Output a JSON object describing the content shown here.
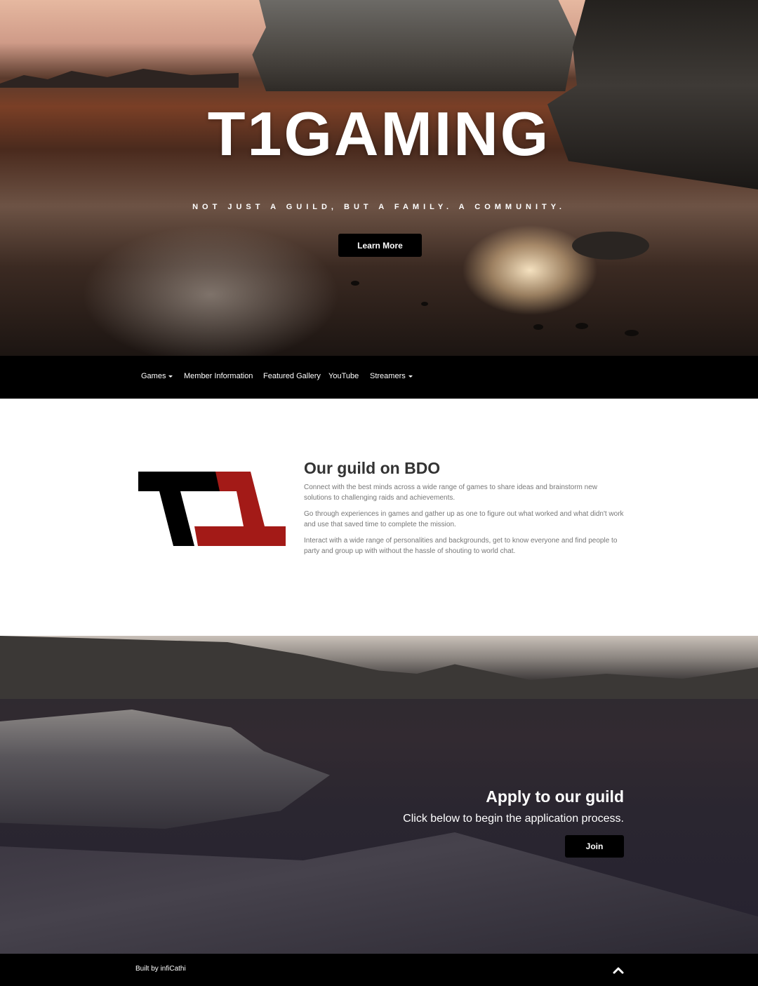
{
  "hero": {
    "title": "T1GAMING",
    "subtitle": "NOT JUST A GUILD, BUT A FAMILY. A COMMUNITY.",
    "button_label": "Learn More"
  },
  "nav": {
    "items": [
      {
        "label": "Games",
        "dropdown": true
      },
      {
        "label": "Member Information",
        "dropdown": false
      },
      {
        "label": "Featured Gallery",
        "dropdown": false
      },
      {
        "label": "YouTube",
        "dropdown": false
      },
      {
        "label": "Streamers",
        "dropdown": true
      }
    ]
  },
  "about": {
    "title": "Our guild on BDO",
    "paragraphs": [
      "Connect with the best minds across a wide range of games to share ideas and brainstorm new solutions to challenging raids and achievements.",
      "Go through experiences in games and gather up as one to figure out what worked and what didn't work and use that saved time to complete the mission.",
      "Interact with a wide range of personalities and backgrounds, get to know everyone and find people to party and group up with without the hassle of shouting to world chat."
    ]
  },
  "apply": {
    "title": "Apply to our guild",
    "subtitle": "Click below to begin the application process.",
    "button_label": "Join"
  },
  "footer": {
    "credit": "Built by infiCathi"
  },
  "colors": {
    "logo_black": "#000000",
    "logo_red": "#a31a17",
    "nav_bg": "#000000"
  }
}
